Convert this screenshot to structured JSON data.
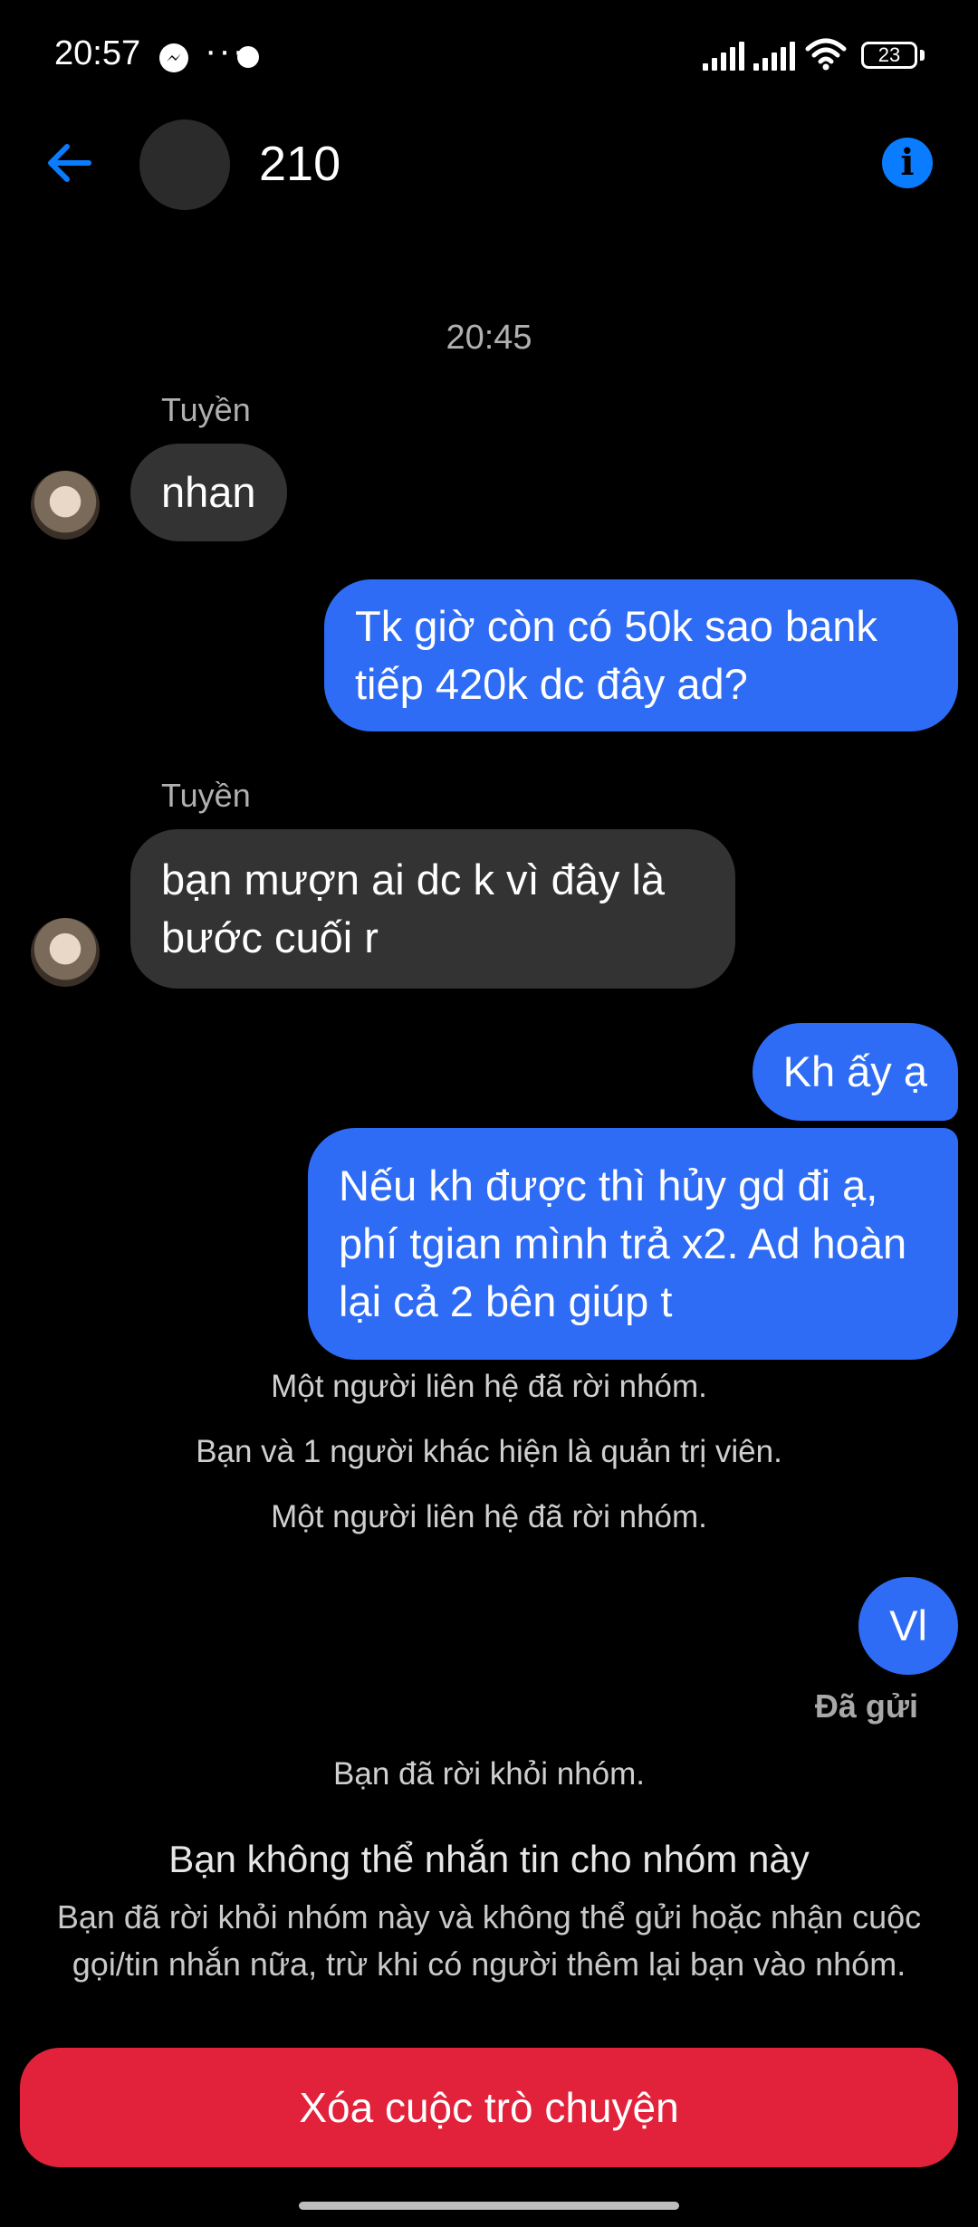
{
  "status_bar": {
    "time": "20:57",
    "dots": "···",
    "battery": "23"
  },
  "header": {
    "title": "210"
  },
  "conversation": {
    "timestamp": "20:45",
    "messages": [
      {
        "sender": "Tuyền",
        "text": "nhan"
      },
      {
        "text": "Tk giờ còn có 50k sao bank tiếp 420k dc đây ad?"
      },
      {
        "sender": "Tuyền",
        "text": "bạn mượn ai dc k vì đây là bước cuối r"
      },
      {
        "text": "Kh ấy ạ"
      },
      {
        "text": "Nếu kh được thì hủy gd đi ạ, phí tgian mình trả x2. Ad hoàn lại cả 2 bên giúp t"
      },
      {
        "text": "Vl"
      }
    ],
    "system_messages": [
      "Một người liên hệ đã rời nhóm.",
      "Bạn và 1 người khác hiện là quản trị viên.",
      "Một người liên hệ đã rời nhóm.",
      "Bạn đã rời khỏi nhóm."
    ],
    "sent_status": "Đã gửi"
  },
  "notice": {
    "title": "Bạn không thể nhắn tin cho nhóm này",
    "body": "Bạn đã rời khỏi nhóm này và không thể gửi hoặc nhận cuộc gọi/tin nhắn nữa, trừ khi có người thêm lại bạn vào nhóm."
  },
  "actions": {
    "delete_label": "Xóa cuộc trò chuyện"
  },
  "colors": {
    "accent": "#0a7cff",
    "outgoing_bubble": "#2e6cf6",
    "incoming_bubble": "#333333",
    "danger": "#e2223a"
  },
  "icons": [
    "messenger-icon",
    "signal-icon",
    "wifi-icon",
    "battery-icon",
    "back-arrow-icon",
    "info-icon"
  ]
}
